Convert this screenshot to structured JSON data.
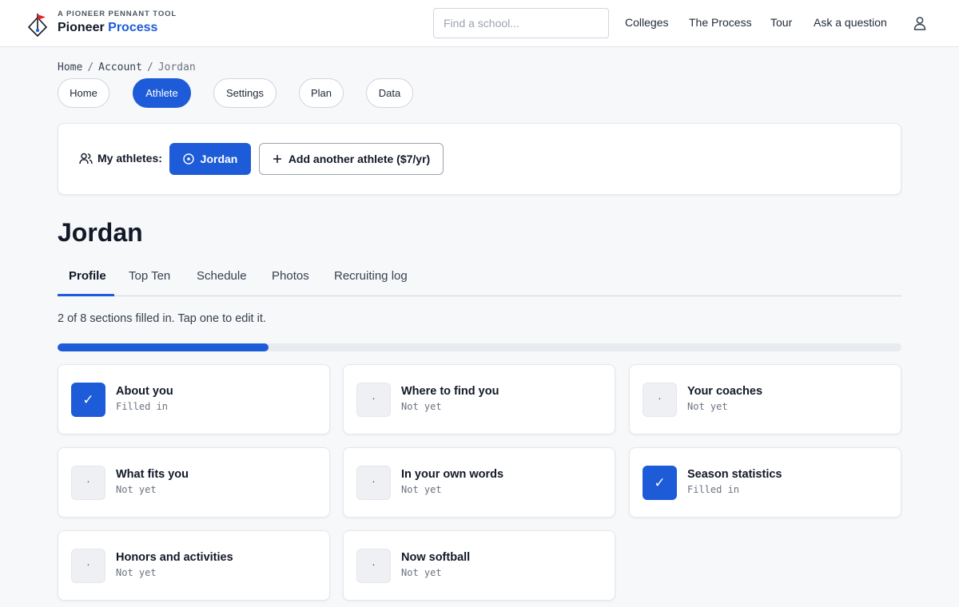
{
  "brand": {
    "tagline": "A PIONEER PENNANT TOOL",
    "name_part1": "Pioneer",
    "name_part2": "Process",
    "logo_icon": "pennant-compass-icon"
  },
  "search": {
    "placeholder": "Find a school..."
  },
  "nav": {
    "colleges": "Colleges",
    "process": "The Process",
    "tour": "Tour",
    "ask": "Ask a question",
    "user_icon": "user-icon"
  },
  "breadcrumb": {
    "home": "Home",
    "account": "Account",
    "current": "Jordan",
    "separator": "/"
  },
  "pills": {
    "home": "Home",
    "athlete": "Athlete",
    "settings": "Settings",
    "plan": "Plan",
    "data": "Data"
  },
  "athletes": {
    "label": "My athletes:",
    "current": "Jordan",
    "add_label": "Add another athlete ($7/yr)"
  },
  "page": {
    "title": "Jordan"
  },
  "subtabs": {
    "profile": "Profile",
    "top_ten": "Top Ten",
    "schedule": "Schedule",
    "photos": "Photos",
    "recruiting_log": "Recruiting log"
  },
  "progress": {
    "text": "2 of 8 sections filled in. Tap one to edit it.",
    "filled": 2,
    "total": 8
  },
  "sections": [
    {
      "title": "About you",
      "status": "Filled in",
      "mark": "✓"
    },
    {
      "title": "Where to find you",
      "status": "Not yet",
      "mark": "·"
    },
    {
      "title": "Your coaches",
      "status": "Not yet",
      "mark": "·"
    },
    {
      "title": "What fits you",
      "status": "Not yet",
      "mark": "·"
    },
    {
      "title": "In your own words",
      "status": "Not yet",
      "mark": "·"
    },
    {
      "title": "Season statistics",
      "status": "Filled in",
      "mark": "✓"
    },
    {
      "title": "Honors and activities",
      "status": "Not yet",
      "mark": "·"
    },
    {
      "title": "Now softball",
      "status": "Not yet",
      "mark": "·"
    }
  ],
  "colors": {
    "accent": "#1d5bd8",
    "pennant_red": "#dc2626",
    "background": "#f7f8fa"
  }
}
